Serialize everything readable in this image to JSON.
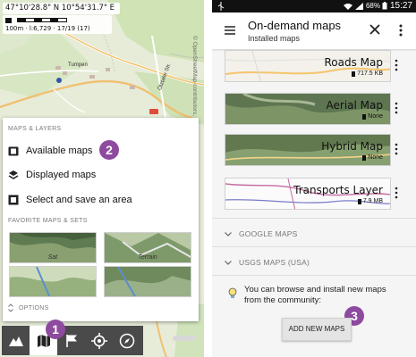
{
  "left_screen": {
    "map": {
      "coordinates": "47°10'28.8\" N 10°54'31.7\" E",
      "scale_text": "100m · l:6,729 · 17/19 (17)",
      "copyright": "© OpenStreetMap contributors, CC-BY-SA",
      "labels": [
        "Tumpen",
        "Ötztaler Str."
      ],
      "road_badge": "B186"
    },
    "panel": {
      "section_title": "MAPS & LAYERS",
      "items": [
        {
          "label": "Available maps",
          "icon": "map-book-icon"
        },
        {
          "label": "Displayed maps",
          "icon": "layers-icon"
        },
        {
          "label": "Select and save an area",
          "icon": "download-area-icon"
        }
      ],
      "favorites_title": "FAVORITE MAPS & SETS",
      "favorites": [
        {
          "label": "Sat"
        },
        {
          "label": "Terrain"
        },
        {
          "label": ""
        },
        {
          "label": ""
        }
      ],
      "options_label": "OPTIONS"
    },
    "callouts": [
      "2",
      "1"
    ],
    "toolbar": [
      "mountain-map-icon",
      "map-icon",
      "flag-icon",
      "crosshair-icon",
      "compass-icon"
    ]
  },
  "right_screen": {
    "statusbar": {
      "battery": "68%",
      "time": "15:27"
    },
    "appbar": {
      "title": "On-demand maps",
      "subtitle": "Installed maps"
    },
    "maps": [
      {
        "name": "Roads Map",
        "size": "717.5 KB",
        "variant": "roads"
      },
      {
        "name": "Aerial Map",
        "size": "None",
        "variant": "aerial"
      },
      {
        "name": "Hybrid Map",
        "size": "None",
        "variant": "hybrid"
      },
      {
        "name": "Transports Layer",
        "size": "7.9 MB",
        "variant": "transport"
      }
    ],
    "groups": [
      "GOOGLE MAPS",
      "USGS MAPS (USA)"
    ],
    "browse_text": "You can browse and install new maps from the community:",
    "add_button": "ADD NEW MAPS",
    "callout": "3"
  },
  "colors": {
    "callout": "#8e4a9f",
    "toolbar": "#4a4a4a",
    "statusbar": "#111111"
  }
}
